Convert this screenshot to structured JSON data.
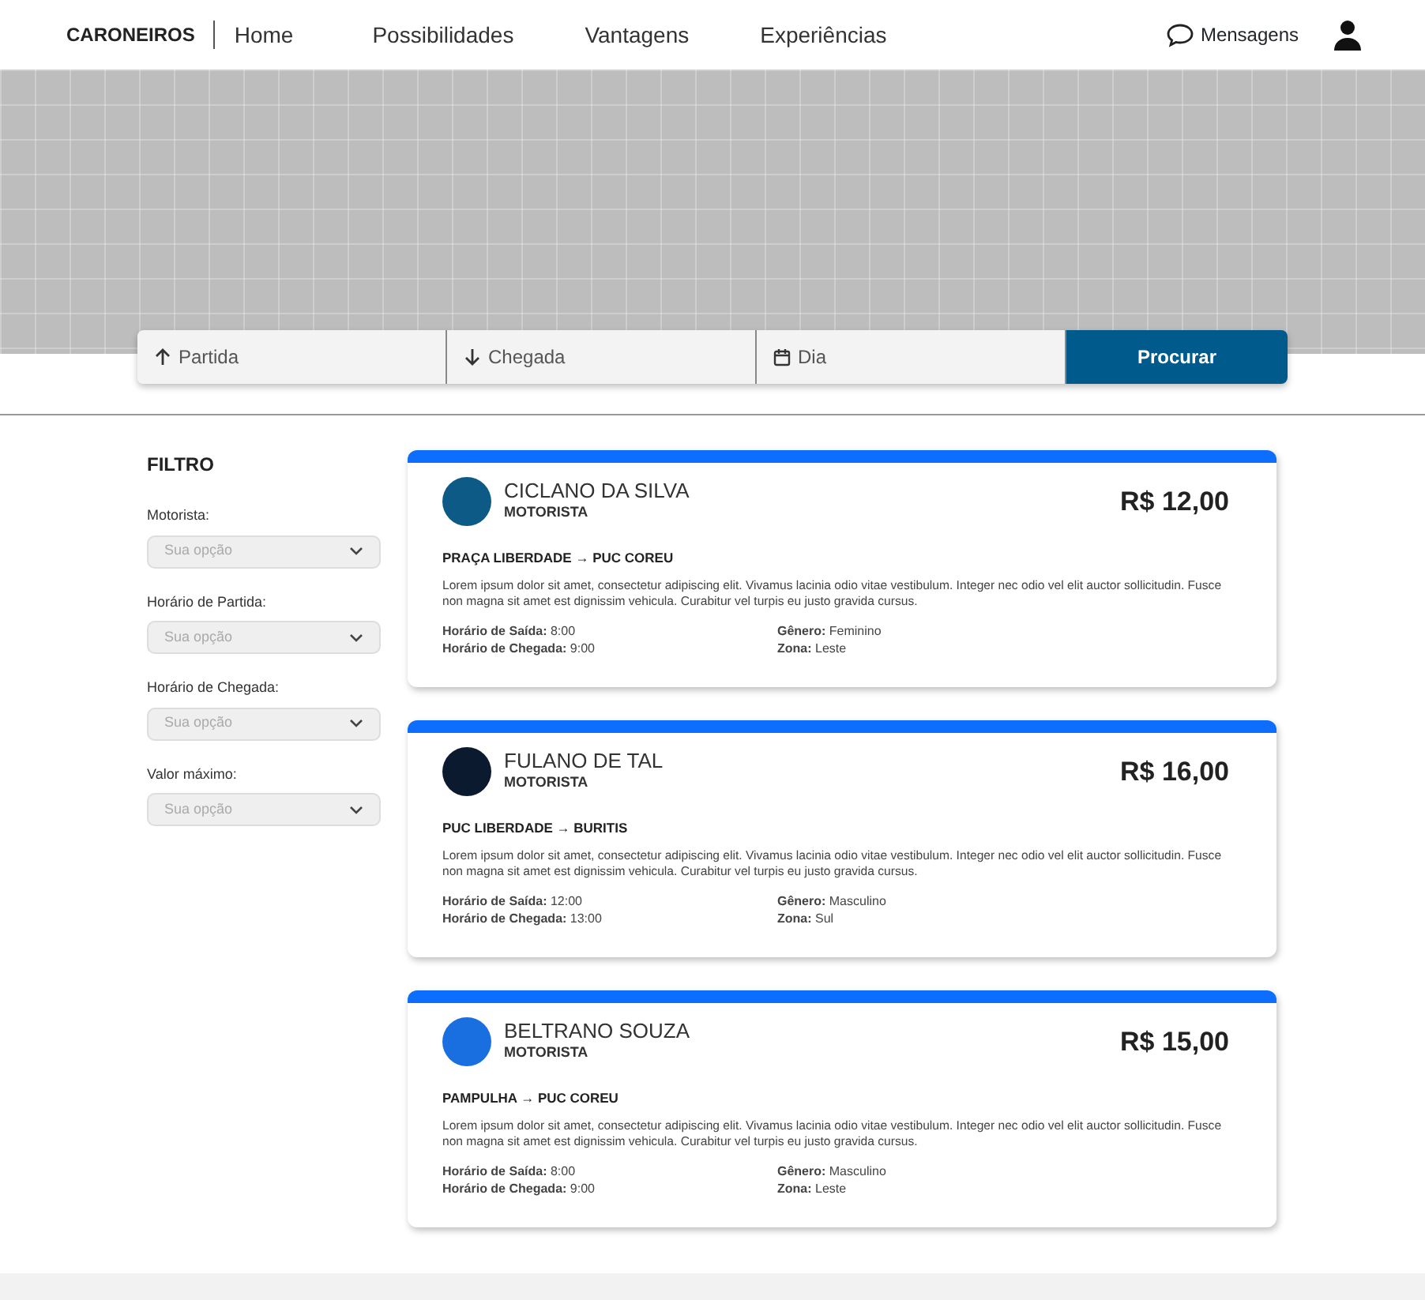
{
  "navbar": {
    "brand": "CARONEIROS",
    "links": [
      "Home",
      "Possibilidades",
      "Vantagens",
      "Experiências"
    ],
    "messages": "Mensagens"
  },
  "search": {
    "fields": [
      {
        "kind": "departure",
        "placeholder": "Partida"
      },
      {
        "kind": "arrival",
        "placeholder": "Chegada"
      },
      {
        "kind": "date",
        "placeholder": "Dia"
      }
    ],
    "button": "Procurar"
  },
  "filter": {
    "title": "FILTRO",
    "fields": [
      {
        "label": "Motorista:",
        "placeholder": "Sua opção"
      },
      {
        "label": "Horário de Partida:",
        "placeholder": "Sua opção"
      },
      {
        "label": "Horário de Chegada:",
        "placeholder": "Sua opção"
      },
      {
        "label": "Valor máximo:",
        "placeholder": "Sua opção"
      }
    ]
  },
  "rides": [
    {
      "name": "CICLANO DA SILVA",
      "role": "MOTORISTA",
      "color": "#0d5a86",
      "price": "R$ 12,00",
      "route": "PRAÇA LIBERDADE → PUC COREU",
      "description": "Lorem ipsum dolor sit amet, consectetur adipiscing elit. Vivamus lacinia odio vitae vestibulum. Integer nec odio vel elit auctor sollicitudin. Fusce non magna sit amet est dignissim vehicula. Curabitur vel turpis eu justo gravida cursus.",
      "details": [
        "**Horário de Saída:** 8:00",
        "**Horário de Chegada:** 9:00",
        "**Gênero:** Feminino",
        "**Zona:** Leste"
      ]
    },
    {
      "name": "FULANO DE TAL",
      "role": "MOTORISTA",
      "color": "#0b1a2e",
      "price": "R$ 16,00",
      "route": "PUC LIBERDADE → BURITIS",
      "description": "Lorem ipsum dolor sit amet, consectetur adipiscing elit. Vivamus lacinia odio vitae vestibulum. Integer nec odio vel elit auctor sollicitudin. Fusce non magna sit amet est dignissim vehicula. Curabitur vel turpis eu justo gravida cursus.",
      "details": [
        "**Horário de Saída:** 12:00",
        "**Horário de Chegada:** 13:00",
        "**Gênero:** Masculino",
        "**Zona:** Sul"
      ]
    },
    {
      "name": "BELTRANO SOUZA",
      "role": "MOTORISTA",
      "color": "#1a6fe0",
      "price": "R$ 15,00",
      "route": "PAMPULHA → PUC COREU",
      "description": "Lorem ipsum dolor sit amet, consectetur adipiscing elit. Vivamus lacinia odio vitae vestibulum. Integer nec odio vel elit auctor sollicitudin. Fusce non magna sit amet est dignissim vehicula. Curabitur vel turpis eu justo gravida cursus.",
      "details": [
        "**Horário de Saída:** 8:00",
        "**Horário de Chegada:** 9:00",
        "**Gênero:** Masculino",
        "**Zona:** Leste"
      ]
    }
  ]
}
